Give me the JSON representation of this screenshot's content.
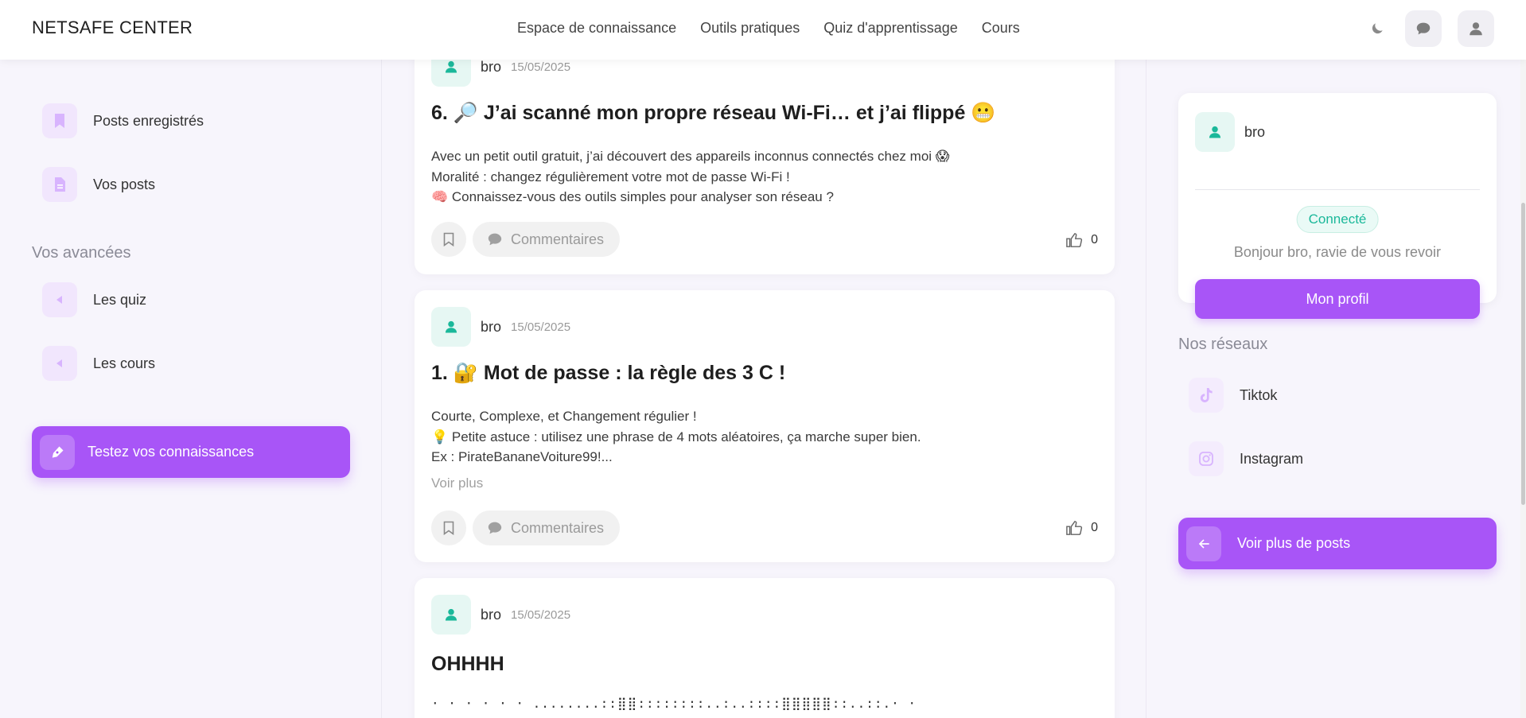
{
  "navbar": {
    "brand": "NETSAFE CENTER",
    "links": [
      "Espace de connaissance",
      "Outils pratiques",
      "Quiz d'apprentissage",
      "Cours"
    ],
    "icons": [
      "moon-icon",
      "chat-icon",
      "user-icon"
    ]
  },
  "left_sidebar": {
    "items": [
      {
        "label": "Posts enregistrés",
        "icon": "bookmark-icon"
      },
      {
        "label": "Vos posts",
        "icon": "document-icon"
      }
    ],
    "section_title": "Vos avancées",
    "progress_items": [
      {
        "label": "Les quiz",
        "icon": "chevron-left-icon"
      },
      {
        "label": "Les cours",
        "icon": "chevron-left-icon"
      }
    ],
    "cta_label": "Testez vos connaissances"
  },
  "posts": [
    {
      "author": "bro",
      "date": "15/05/2025",
      "title": "6. 🔎 J’ai scanné mon propre réseau Wi-Fi… et j’ai flippé 😬",
      "lines": [
        "Avec un petit outil gratuit, j’ai découvert des appareils inconnus connectés chez moi 😱",
        "Moralité : changez régulièrement votre mot de passe Wi-Fi !",
        "🧠 Connaissez-vous des outils simples pour analyser son réseau ?"
      ],
      "comments_label": "Commentaires",
      "likes": "0"
    },
    {
      "author": "bro",
      "date": "15/05/2025",
      "title": "1. 🔐 Mot de passe : la règle des 3 C !",
      "lines": [
        "Courte, Complexe, et Changement régulier !",
        "💡 Petite astuce : utilisez une phrase de 4 mots aléatoires, ça marche super bien.",
        "Ex : PirateBananeVoiture99!..."
      ],
      "more_label": "Voir plus",
      "comments_label": "Commentaires",
      "likes": "0"
    },
    {
      "author": "bro",
      "date": "15/05/2025",
      "title": "OHHHH",
      "ascii": "· · · · · · ........::⣿⣿::::::::..:..::::⣿⣿⣿⣿⣿::..::.· ·"
    }
  ],
  "right_sidebar": {
    "profile": {
      "name": "bro",
      "status": "Connecté",
      "greeting": "Bonjour bro, ravie de vous revoir",
      "button": "Mon profil"
    },
    "networks_title": "Nos réseaux",
    "networks": [
      {
        "label": "Tiktok",
        "icon": "tiktok-icon"
      },
      {
        "label": "Instagram",
        "icon": "instagram-icon"
      }
    ],
    "cta_label": "Voir plus de posts"
  },
  "colors": {
    "accent": "#a855f7",
    "accent_soft": "#f1e6fd",
    "teal": "#1bb89a",
    "background": "#f7f5fc"
  }
}
